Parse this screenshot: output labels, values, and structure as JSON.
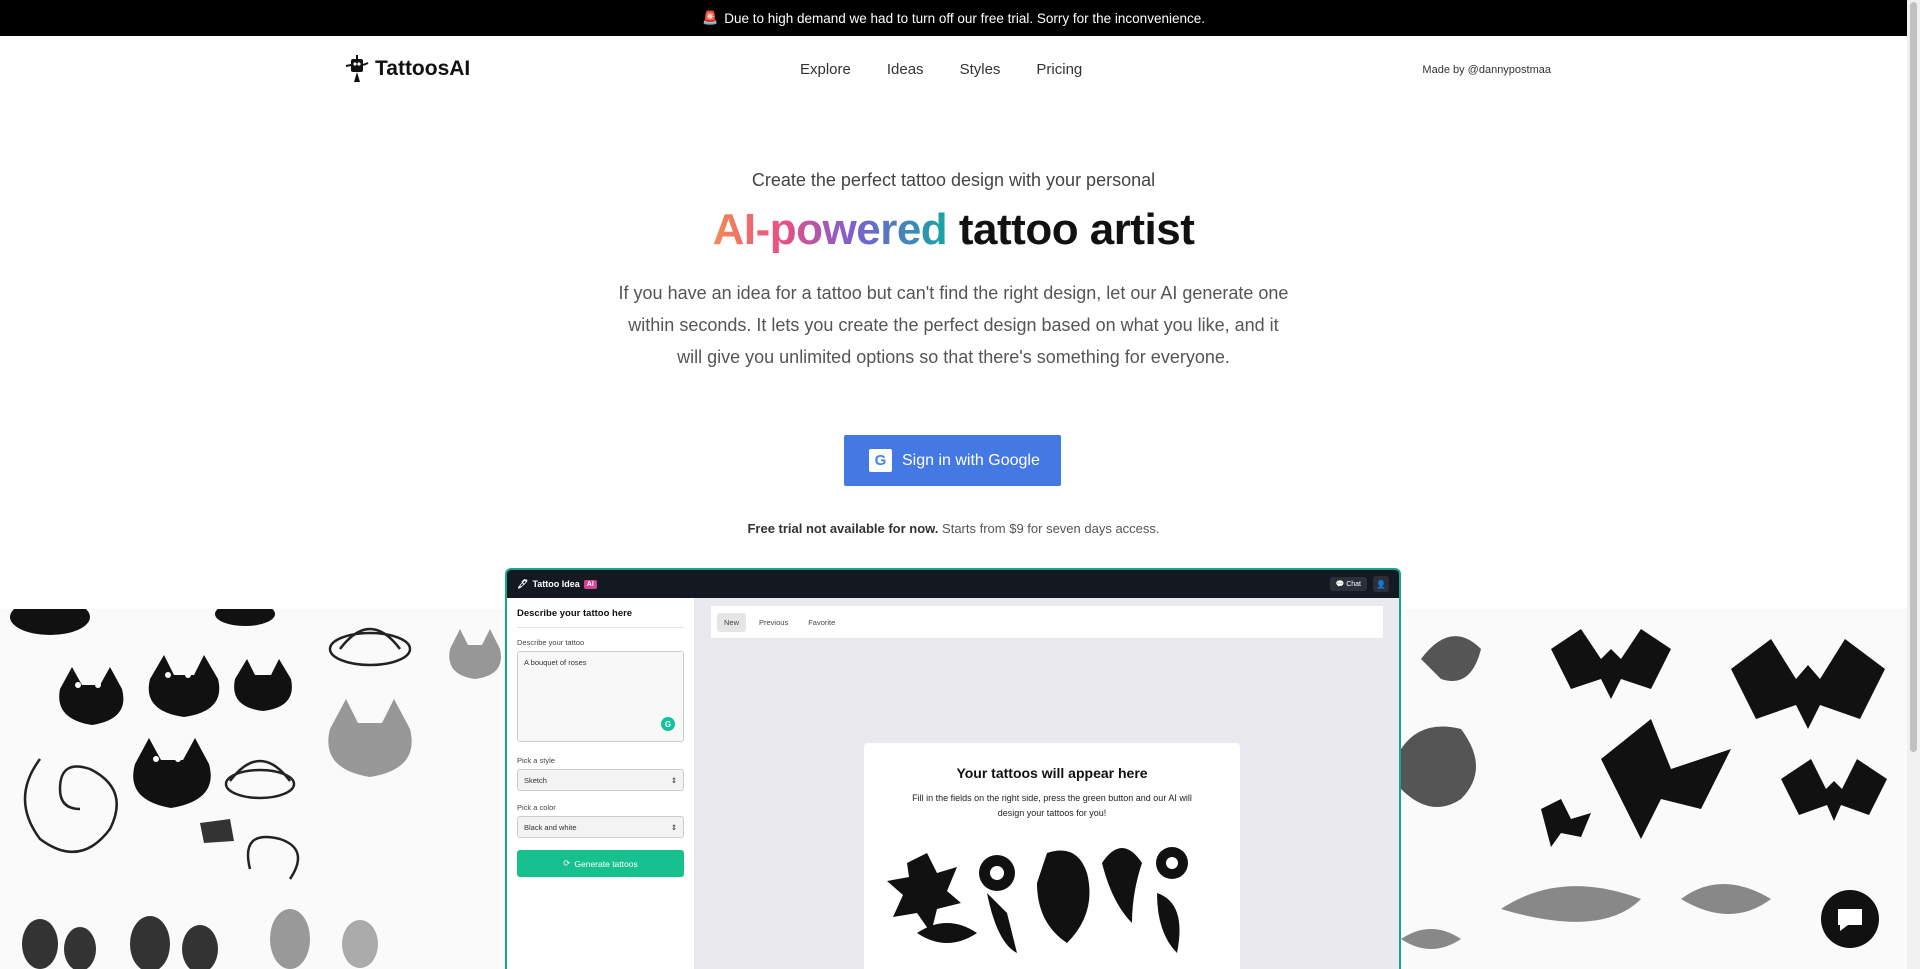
{
  "banner": {
    "icon": "siren-icon",
    "text": "Due to high demand we had to turn off our free trial. Sorry for the inconvenience."
  },
  "nav": {
    "logo_text": "TattoosAI",
    "items": [
      "Explore",
      "Ideas",
      "Styles",
      "Pricing"
    ],
    "made_by": "Made by @dannypostmaa"
  },
  "hero": {
    "pre": "Create the perfect tattoo design with your personal",
    "title_gradient": "AI-powered",
    "title_rest": " tattoo artist",
    "description": "If you have an idea for a tattoo but can't find the right design, let our AI generate one within seconds. It lets you create the perfect design based on what you like, and it will give you unlimited options so that there's something for everyone.",
    "google_button": "Sign in with Google",
    "google_glyph": "G",
    "trial_bold": "Free trial not available for now.",
    "trial_rest": " Starts from $9 for seven days access."
  },
  "app": {
    "title": "Tattoo Idea",
    "badge": "AI",
    "chat_label": "Chat",
    "form_heading": "Describe your tattoo here",
    "describe_label": "Describe your tattoo",
    "describe_value": "A bouquet of roses",
    "grammarly_glyph": "G",
    "style_label": "Pick a style",
    "style_value": "Sketch",
    "color_label": "Pick a color",
    "color_value": "Black and white",
    "generate_label": "Generate tattoos",
    "tabs": [
      "New",
      "Previous",
      "Favorite"
    ],
    "card_title": "Your tattoos will appear here",
    "card_text": "Fill in the fields on the right side, press the green button and our AI will design your tattoos for you!"
  },
  "colors": {
    "accent_green": "#17c08f",
    "google_blue": "#4478e3",
    "app_border": "#14a58f"
  }
}
